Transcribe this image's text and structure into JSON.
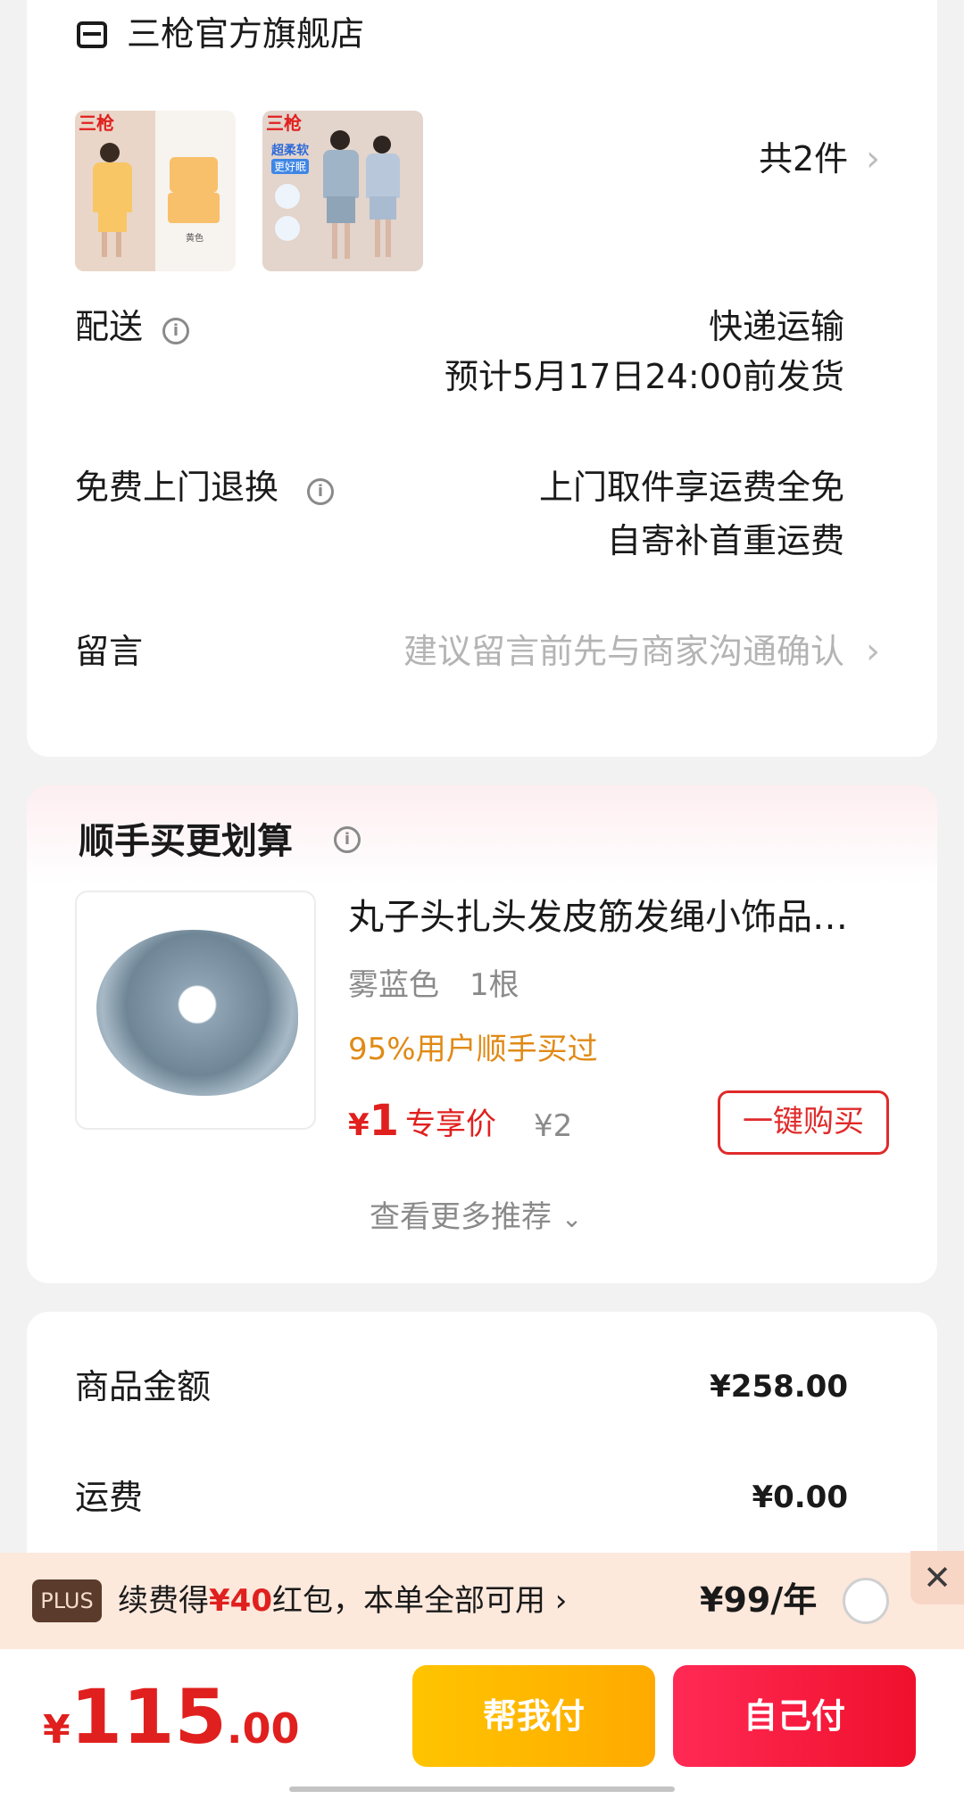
{
  "store": {
    "name": "三枪官方旗舰店",
    "icon": "store-icon"
  },
  "products": {
    "thumbs": [
      {
        "logo": "三枪",
        "color_label": "黄色",
        "theme": "yellow"
      },
      {
        "logo": "三枪",
        "badge": "超柔软",
        "badge2": "更好眠",
        "theme": "blue"
      }
    ],
    "count_label": "共2件"
  },
  "delivery": {
    "label": "配送",
    "method": "快递运输",
    "eta": "预计5月17日24:00前发货"
  },
  "return": {
    "label": "免费上门退换",
    "line1": "上门取件享运费全免",
    "line2": "自寄补首重运费"
  },
  "message": {
    "label": "留言",
    "placeholder": "建议留言前先与商家沟通确认"
  },
  "addon": {
    "title": "顺手买更划算",
    "product_name": "丸子头扎头发皮筋发绳小饰品…",
    "spec": "雾蓝色　1根",
    "social_proof": "95%用户顺手买过",
    "price_symbol": "¥",
    "price": "1",
    "price_tag": "专享价",
    "original_price": "¥2",
    "buy_button": "一键购买",
    "more_label": "查看更多推荐"
  },
  "summary": {
    "goods_label": "商品金额",
    "goods_value": "¥258.00",
    "shipping_label": "运费",
    "shipping_value": "¥0.00"
  },
  "plus": {
    "badge": "PLUS",
    "text_pre": "续费得",
    "text_amount": "¥40",
    "text_post": "红包，本单全部可用",
    "price": "¥99/年"
  },
  "checkout": {
    "symbol": "¥",
    "total_int": "115",
    "total_dec": ".00",
    "help_pay": "帮我付",
    "self_pay": "自己付"
  },
  "colors": {
    "accent_red": "#e0201e",
    "orange_text": "#e08a16",
    "gold_button": "#ffb400",
    "red_button": "#f5173f"
  }
}
